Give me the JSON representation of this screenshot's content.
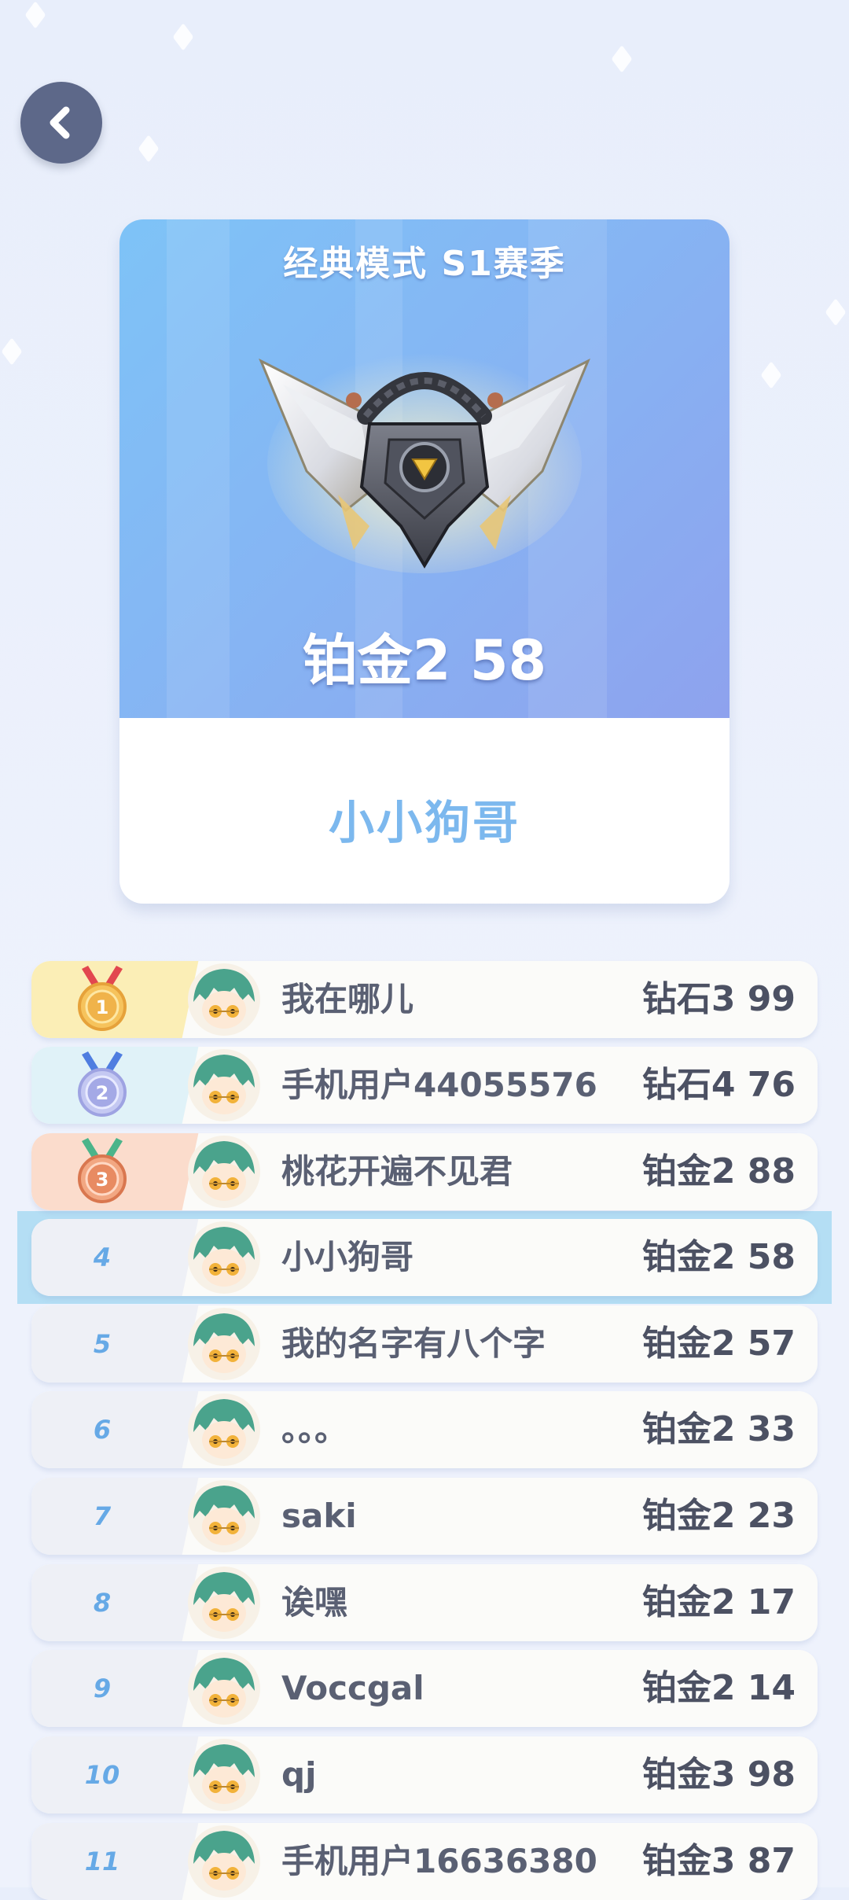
{
  "header": {
    "back_icon": "chevron-left-icon"
  },
  "rank_card": {
    "season_title": "经典模式 S1赛季",
    "badge_icon": "platinum-winged-badge-icon",
    "rank_text": "铂金2 58",
    "player_name": "小小狗哥"
  },
  "colors": {
    "card_gradient_start": "#7ec3f7",
    "card_gradient_end": "#8ea2ee",
    "player_name": "#7cb8ee",
    "rank_number": "#66a9e6",
    "highlight": "#a9daf2",
    "gold": "#f0b34a",
    "silver": "#a4a9e6",
    "bronze": "#e88b62"
  },
  "leaderboard": {
    "rows": [
      {
        "rank": "1",
        "medal": "gold-medal-icon",
        "name": "我在哪儿",
        "score": "钻石3 99"
      },
      {
        "rank": "2",
        "medal": "silver-medal-icon",
        "name": "手机用户44055576",
        "score": "钻石4 76"
      },
      {
        "rank": "3",
        "medal": "bronze-medal-icon",
        "name": "桃花开遍不见君",
        "score": "铂金2 88"
      },
      {
        "rank": "4",
        "name": "小小狗哥",
        "score": "铂金2 58",
        "current_user": true
      },
      {
        "rank": "5",
        "name": "我的名字有八个字",
        "score": "铂金2 57"
      },
      {
        "rank": "6",
        "name": "。。。",
        "score": "铂金2 33"
      },
      {
        "rank": "7",
        "name": "saki",
        "score": "铂金2 23"
      },
      {
        "rank": "8",
        "name": "诶嘿",
        "score": "铂金2 17"
      },
      {
        "rank": "9",
        "name": "Voccgal",
        "score": "铂金2 14"
      },
      {
        "rank": "10",
        "name": "qj",
        "score": "铂金3 98"
      },
      {
        "rank": "11",
        "name": "手机用户16636380",
        "score": "铂金3 87"
      }
    ]
  }
}
